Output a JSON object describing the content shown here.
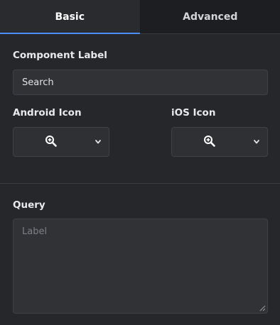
{
  "tabs": [
    {
      "label": "Basic",
      "active": true
    },
    {
      "label": "Advanced",
      "active": false
    }
  ],
  "component_label": {
    "label": "Component Label",
    "value": "Search"
  },
  "android_icon": {
    "label": "Android Icon",
    "icon": "zoom-in-icon"
  },
  "ios_icon": {
    "label": "iOS Icon",
    "icon": "zoom-in-icon"
  },
  "query": {
    "label": "Query",
    "placeholder": "Label"
  },
  "colors": {
    "accent": "#4a8df6",
    "background": "#26272b",
    "tab_bar": "#1d1e21"
  }
}
